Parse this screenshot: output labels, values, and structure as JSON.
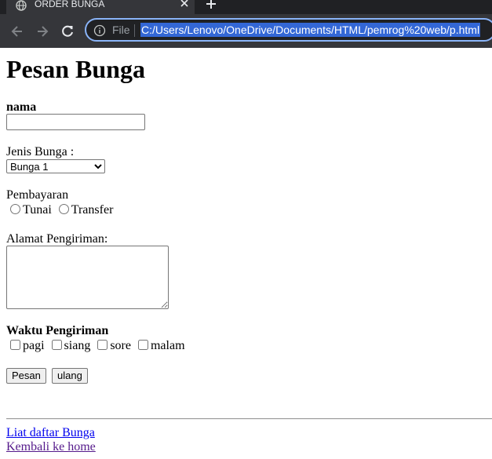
{
  "browser": {
    "tab_title": "ORDER BUNGA",
    "scheme_label": "File",
    "url": "C:/Users/Lenovo/OneDrive/Documents/HTML/pemrog%20web/p.html",
    "colors": {
      "frame": "#202124",
      "toolbar": "#35363a",
      "focus_ring": "#8ab4f8",
      "url_selection": "#3367d6"
    },
    "icons": [
      "globe-icon",
      "close-icon",
      "new-tab-icon",
      "back-icon",
      "forward-icon",
      "reload-icon",
      "info-icon"
    ]
  },
  "page": {
    "title": "Pesan Bunga",
    "name_label": "nama",
    "name_value": "",
    "flower_label": "Jenis Bunga :",
    "flower_selected": "Bunga 1",
    "payment_label": "Pembayaran",
    "payment_options": [
      "Tunai",
      "Transfer"
    ],
    "address_label": "Alamat Pengiriman:",
    "address_value": "",
    "time_label": "Waktu Pengiriman",
    "time_options": [
      "pagi",
      "siang",
      "sore",
      "malam"
    ],
    "submit_label": "Pesan",
    "reset_label": "ulang",
    "links": [
      "Liat daftar Bunga",
      "Kembali ke home"
    ],
    "colors": {
      "link": "#0000ee",
      "visited_link": "#551a8b"
    }
  }
}
